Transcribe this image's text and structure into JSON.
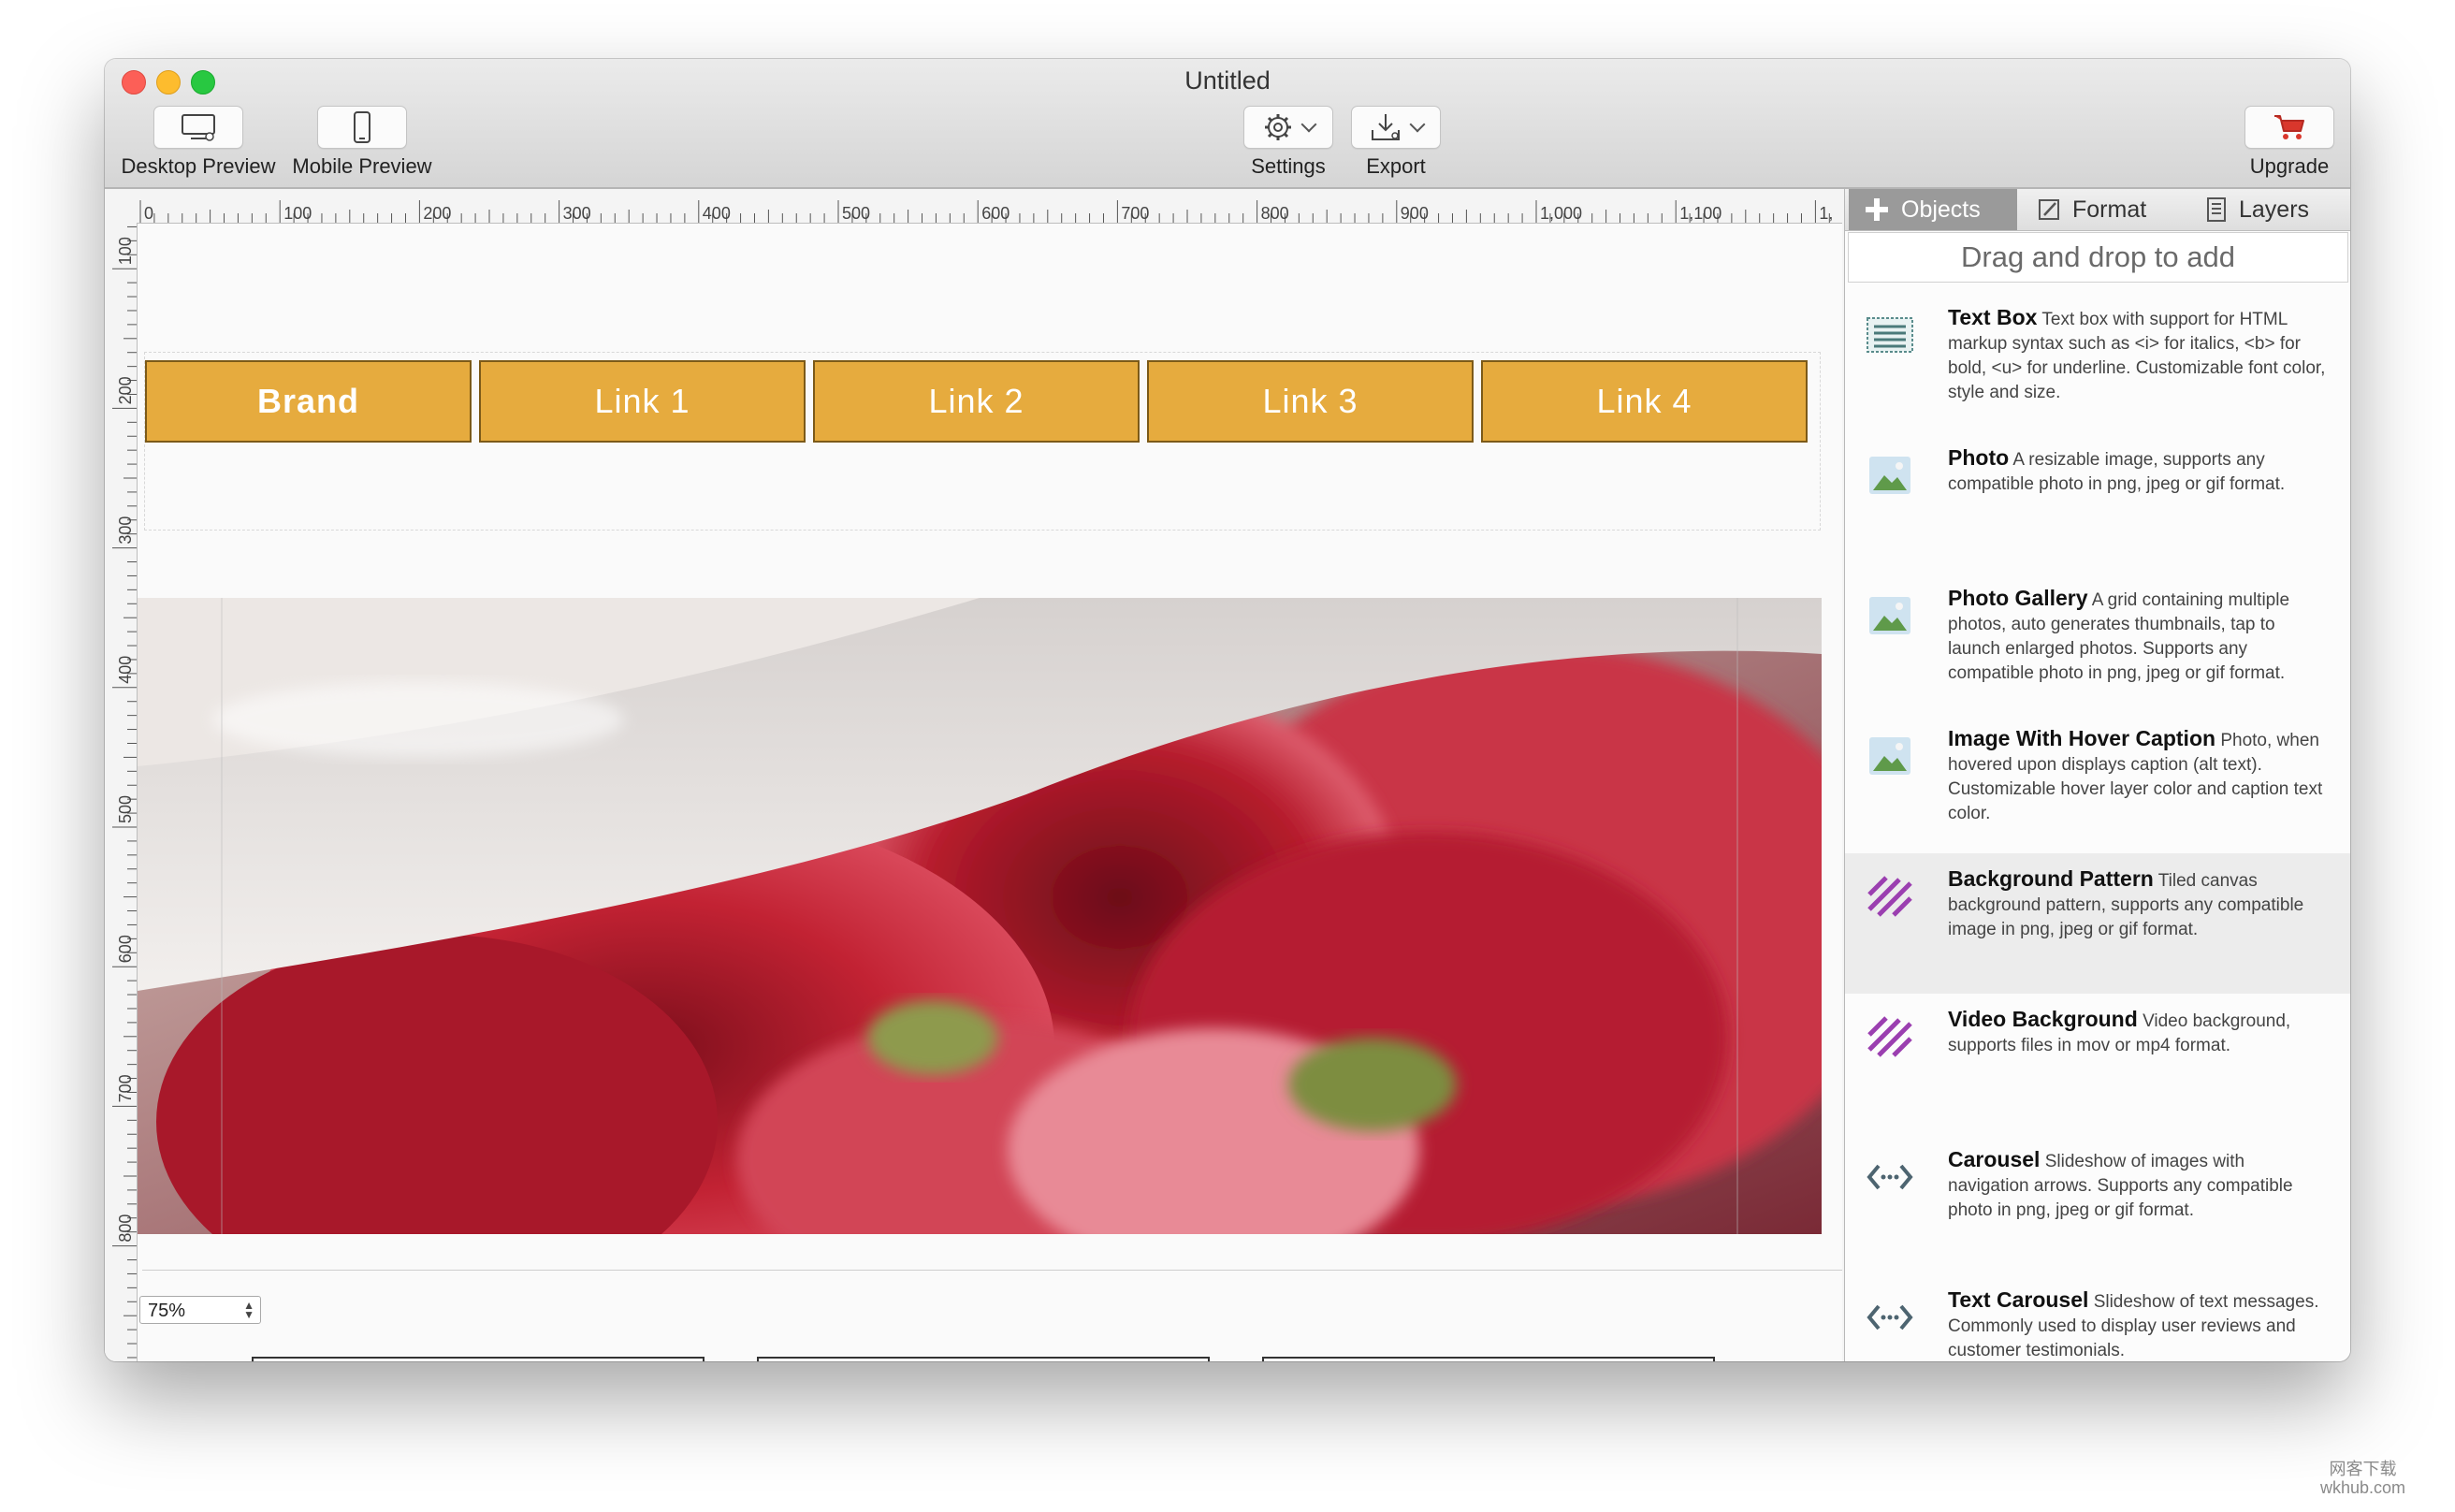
{
  "window": {
    "title": "Untitled"
  },
  "toolbar": {
    "desktop_preview": "Desktop Preview",
    "mobile_preview": "Mobile Preview",
    "settings": "Settings",
    "export": "Export",
    "upgrade": "Upgrade"
  },
  "ruler": {
    "top_ticks": [
      "0",
      "100",
      "200",
      "300",
      "400",
      "500",
      "600",
      "700",
      "800",
      "900",
      "1,000",
      "1,100",
      "1,"
    ],
    "left_ticks": [
      "100",
      "200",
      "300",
      "400",
      "500",
      "600",
      "700",
      "800"
    ]
  },
  "navbar": {
    "brand": "Brand",
    "links": [
      "Link 1",
      "Link 2",
      "Link 3",
      "Link 4"
    ],
    "color": "#e6ab3e"
  },
  "zoom": {
    "value": "75%"
  },
  "sidebar": {
    "tabs": [
      "Objects",
      "Format",
      "Layers"
    ],
    "active_tab": "Objects",
    "hint": "Drag and drop to add",
    "items": [
      {
        "name": "Text Box",
        "desc": "Text box with support for HTML markup syntax such as <i> for italics, <b> for bold, <u> for underline. Customizable font color, style and size.",
        "icon": "textbox-icon"
      },
      {
        "name": "Photo",
        "desc": "A resizable image, supports any compatible photo in png, jpeg or gif format.",
        "icon": "photo-icon"
      },
      {
        "name": "Photo Gallery",
        "desc": "A grid containing multiple photos, auto generates thumbnails, tap to launch enlarged photos. Supports any compatible photo in png, jpeg or gif format.",
        "icon": "photo-gallery-icon"
      },
      {
        "name": "Image With Hover Caption",
        "desc": "Photo, when hovered upon displays caption (alt text). Customizable hover layer color and caption text color.",
        "icon": "hover-caption-icon"
      },
      {
        "name": "Background Pattern",
        "desc": "Tiled canvas background pattern, supports any compatible image in png, jpeg or gif format.",
        "icon": "pattern-icon"
      },
      {
        "name": "Video Background",
        "desc": "Video background, supports files in mov or mp4 format.",
        "icon": "video-bg-icon"
      },
      {
        "name": "Carousel",
        "desc": "Slideshow of images with navigation arrows.  Supports any compatible photo in png, jpeg or gif format.",
        "icon": "carousel-icon"
      },
      {
        "name": "Text Carousel",
        "desc": "Slideshow of text messages.  Commonly used to display user reviews and customer testimonials.",
        "icon": "text-carousel-icon"
      }
    ]
  },
  "watermark": {
    "line1": "网客下载",
    "line2": "wkhub.com"
  }
}
